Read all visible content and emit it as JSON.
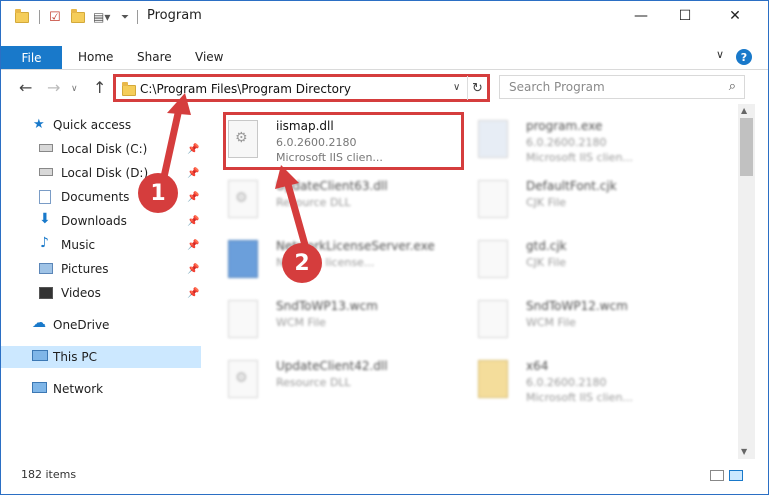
{
  "window": {
    "title": "Program",
    "minimize_glyph": "—",
    "maximize_glyph": "☐",
    "close_glyph": "✕"
  },
  "ribbon": {
    "tabs": [
      "File",
      "Home",
      "Share",
      "View"
    ],
    "help_glyph": "?"
  },
  "address": {
    "path": "C:\\Program Files\\Program Directory",
    "search_placeholder": "Search Program"
  },
  "sidebar": {
    "quick_access": "Quick access",
    "items": [
      {
        "label": "Local Disk (C:)",
        "icon": "drive-icon",
        "pinned": true
      },
      {
        "label": "Local Disk (D:)",
        "icon": "drive-icon",
        "pinned": true
      },
      {
        "label": "Documents",
        "icon": "documents-icon",
        "pinned": true
      },
      {
        "label": "Downloads",
        "icon": "downloads-icon",
        "pinned": true
      },
      {
        "label": "Music",
        "icon": "music-icon",
        "pinned": true
      },
      {
        "label": "Pictures",
        "icon": "pictures-icon",
        "pinned": true
      },
      {
        "label": "Videos",
        "icon": "videos-icon",
        "pinned": true
      }
    ],
    "onedrive": "OneDrive",
    "thispc": "This PC",
    "network": "Network"
  },
  "files": [
    {
      "name": "iismap.dll",
      "line2": "6.0.2600.2180",
      "line3": "Microsoft IIS clien...",
      "type": "dll",
      "highlight": true
    },
    {
      "name": "program.exe",
      "line2": "6.0.2600.2180",
      "line3": "Microsoft IIS clien...",
      "type": "exe"
    },
    {
      "name": "UpdateClient63.dll",
      "line2": "Resource DLL",
      "line3": "",
      "type": "dll"
    },
    {
      "name": "DefaultFont.cjk",
      "line2": "CJK File",
      "line3": "",
      "type": "file"
    },
    {
      "name": "NetworkLicenseServer.exe",
      "line2": "Network license...",
      "line3": "",
      "type": "exe"
    },
    {
      "name": "gtd.cjk",
      "line2": "CJK File",
      "line3": "",
      "type": "file"
    },
    {
      "name": "SndToWP13.wcm",
      "line2": "WCM File",
      "line3": "",
      "type": "file"
    },
    {
      "name": "SndToWP12.wcm",
      "line2": "WCM File",
      "line3": "",
      "type": "file"
    },
    {
      "name": "UpdateClient42.dll",
      "line2": "Resource DLL",
      "line3": "",
      "type": "dll"
    },
    {
      "name": "x64",
      "line2": "6.0.2600.2180",
      "line3": "Microsoft IIS clien...",
      "type": "folder"
    }
  ],
  "status": {
    "count": "182 items"
  },
  "callouts": [
    "1",
    "2"
  ],
  "colors": {
    "accent": "#1979ca",
    "highlight_red": "#d53d3d",
    "selected_bg": "#cce8ff"
  }
}
